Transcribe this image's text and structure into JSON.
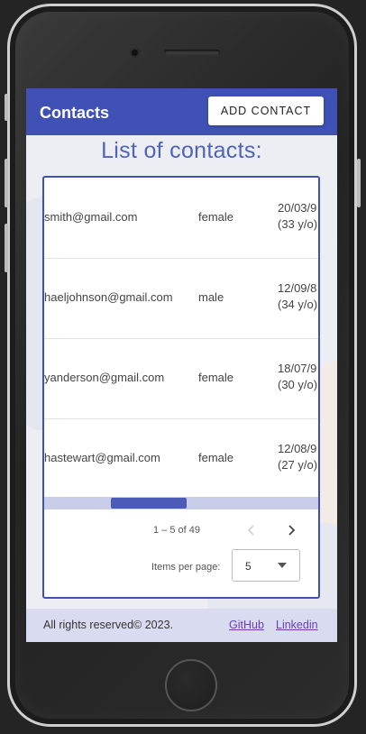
{
  "app": {
    "title": "Contacts",
    "add_button_label": "ADD CONTACT",
    "page_heading": "List of contacts:"
  },
  "contacts": [
    {
      "email": "smith@gmail.com",
      "gender": "female",
      "dob": "20/03/9",
      "age": "(33 y/o)"
    },
    {
      "email": "haeljohnson@gmail.com",
      "gender": "male",
      "dob": "12/09/8",
      "age": "(34 y/o)"
    },
    {
      "email": "yanderson@gmail.com",
      "gender": "female",
      "dob": "18/07/9",
      "age": "(30 y/o)"
    },
    {
      "email": "hastewart@gmail.com",
      "gender": "female",
      "dob": "12/08/9",
      "age": "(27 y/o)"
    }
  ],
  "paginator": {
    "range_label": "1 – 5 of 49",
    "items_per_page_label": "Items per page:",
    "items_per_page_value": "5",
    "prev_icon": "chevron-left-icon",
    "next_icon": "chevron-right-icon"
  },
  "footer": {
    "copyright": "All rights reserved© 2023.",
    "links": [
      "GitHub",
      "Linkedin"
    ]
  },
  "colors": {
    "primary": "#3f51b5",
    "heading": "#4f63b8",
    "link": "#6a3fb0",
    "footer_bg": "#d9dcf0"
  }
}
